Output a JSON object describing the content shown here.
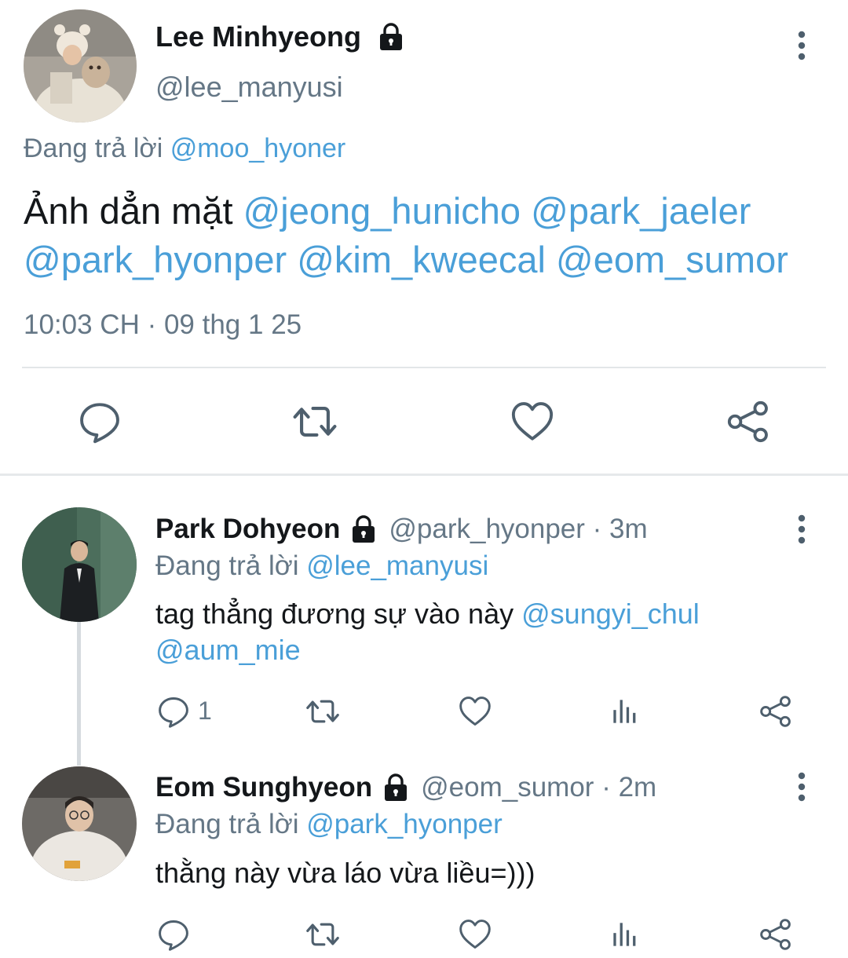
{
  "main_tweet": {
    "author_name": "Lee Minhyeong",
    "author_handle": "@lee_manyusi",
    "replying_prefix": "Đang trả lời",
    "replying_to": "@moo_hyoner",
    "text_plain": "Ảnh dẳn mặt",
    "mentions_line1": [
      "@jeong_hunicho",
      "@park_jaeler"
    ],
    "mentions_line2": [
      "@park_hyonper",
      "@kim_kweecal",
      "@eom_sumor"
    ],
    "timestamp": "10:03 CH · 09 thg 1 25",
    "actions": [
      "reply-icon",
      "retweet-icon",
      "like-icon",
      "share-icon"
    ]
  },
  "replies": [
    {
      "author_name": "Park Dohyeon",
      "author_handle": "@park_hyonper",
      "time": "· 3m",
      "replying_prefix": "Đang trả lời",
      "replying_to": "@lee_manyusi",
      "text_plain": "tag thẳng đương sự vào này",
      "mentions": [
        "@sungyi_chul",
        "@aum_mie"
      ],
      "reply_count": "1",
      "actions": [
        "reply-icon",
        "retweet-icon",
        "like-icon",
        "analytics-icon",
        "share-icon"
      ]
    },
    {
      "author_name": "Eom Sunghyeon",
      "author_handle": "@eom_sumor",
      "time": "· 2m",
      "replying_prefix": "Đang trả lời",
      "replying_to": "@park_hyonper",
      "text_plain": "thằng này vừa láo vừa liều=)))",
      "reply_count": "",
      "actions": [
        "reply-icon",
        "retweet-icon",
        "like-icon",
        "analytics-icon",
        "share-icon"
      ]
    }
  ],
  "colors": {
    "link": "#4a9fd8",
    "secondary_text": "#657786",
    "primary_text": "#14171a",
    "icon": "#4e5f6d",
    "divider": "#e3e6e8"
  }
}
